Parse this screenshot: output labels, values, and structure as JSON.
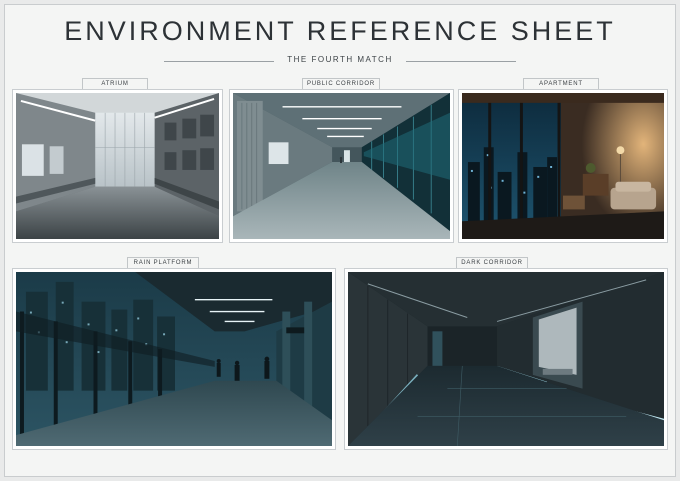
{
  "sheet": {
    "title": "ENVIRONMENT REFERENCE SHEET",
    "subtitle": "THE FOURTH MATCH"
  },
  "panels": [
    {
      "label": "ATRIUM",
      "scene": "atrium-scene"
    },
    {
      "label": "PUBLIC CORRIDOR",
      "scene": "public-corridor-scene"
    },
    {
      "label": "APARTMENT",
      "scene": "apartment-scene"
    },
    {
      "label": "RAIN PLATFORM",
      "scene": "rain-platform-scene"
    },
    {
      "label": "DARK CORRIDOR",
      "scene": "dark-corridor-scene"
    }
  ],
  "colors": {
    "background": "#f4f5f4",
    "text": "#2d3236",
    "frame": "#c9cdd0",
    "night_teal": "#1d3a44",
    "warm_light": "#d9a060"
  }
}
